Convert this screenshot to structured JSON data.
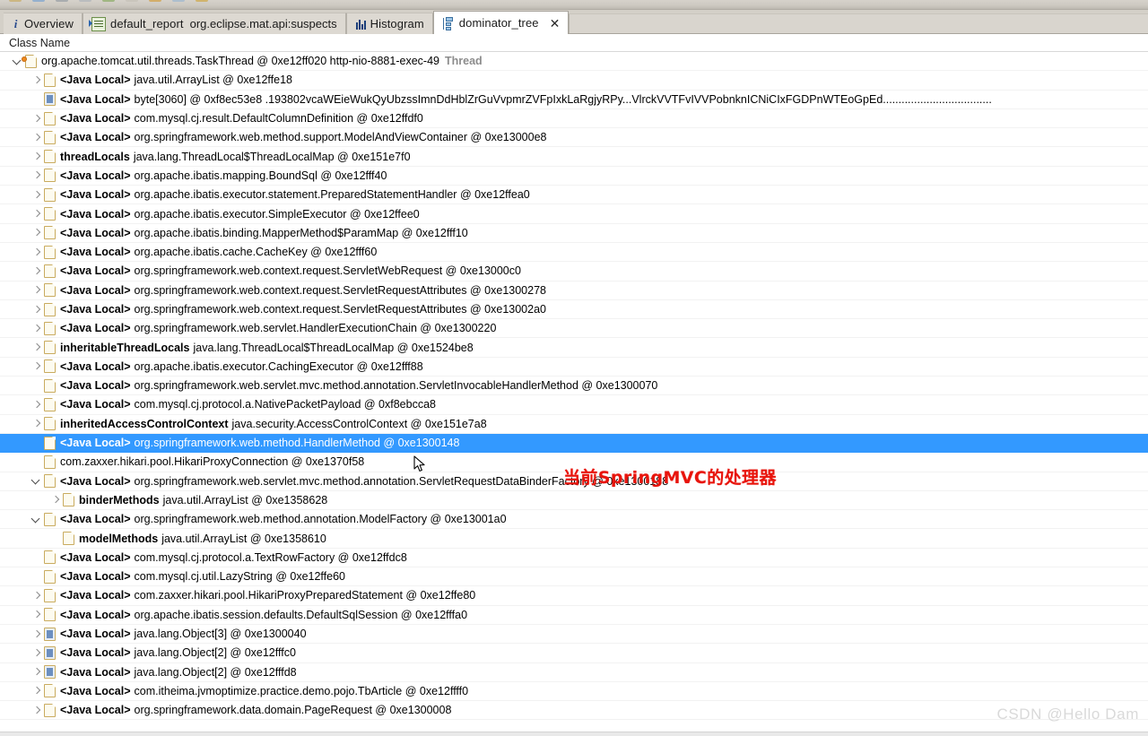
{
  "app": {
    "view_title": "dominator_tree",
    "watermark": "CSDN @Hello Dam"
  },
  "toolbar": {
    "icons": [
      "open-icon",
      "save-icon",
      "print-icon",
      "history-icon",
      "query-icon",
      "inspector-icon",
      "pie-icon",
      "export-icon",
      "settings-icon"
    ]
  },
  "tabs": [
    {
      "label": "Overview",
      "icon": "info-icon",
      "active": false,
      "closable": false,
      "sub": ""
    },
    {
      "label": "default_report",
      "icon": "report-icon",
      "active": false,
      "closable": false,
      "sub": "org.eclipse.mat.api:suspects"
    },
    {
      "label": "Histogram",
      "icon": "histogram-icon",
      "active": false,
      "closable": false,
      "sub": ""
    },
    {
      "label": "dominator_tree",
      "icon": "dominator-tree-icon",
      "active": true,
      "closable": true,
      "sub": ""
    }
  ],
  "tab_close_glyph": "✕",
  "table": {
    "columns": [
      "Class Name"
    ]
  },
  "annotation": {
    "text": "当前SpringMVC的处理器",
    "color": "#e8140c"
  },
  "selection_color": "#3399ff",
  "rows": [
    {
      "indent": 0,
      "twisty": "expanded",
      "icon": "gcroot",
      "strong": "",
      "rest": "org.apache.tomcat.util.threads.TaskThread @ 0xe12ff020  http-nio-8881-exec-49",
      "gray": "Thread",
      "selected": false
    },
    {
      "indent": 1,
      "twisty": "collapsed",
      "icon": "doc",
      "strong": "<Java Local>",
      "rest": "java.util.ArrayList @ 0xe12ffe18",
      "gray": "",
      "selected": false
    },
    {
      "indent": 1,
      "twisty": "none",
      "icon": "array",
      "strong": "<Java Local>",
      "rest": "byte[3060] @ 0xf8ec53e8  .193802vcaWEieWukQyUbzssImnDdHblZrGuVvpmrZVFpIxkLaRgjyRPy...VlrckVVTFvIVVPobnknICNiCIxFGDPnWTEoGpEd...................................",
      "gray": "",
      "selected": false
    },
    {
      "indent": 1,
      "twisty": "collapsed",
      "icon": "doc",
      "strong": "<Java Local>",
      "rest": "com.mysql.cj.result.DefaultColumnDefinition @ 0xe12ffdf0",
      "gray": "",
      "selected": false
    },
    {
      "indent": 1,
      "twisty": "collapsed",
      "icon": "doc",
      "strong": "<Java Local>",
      "rest": "org.springframework.web.method.support.ModelAndViewContainer @ 0xe13000e8",
      "gray": "",
      "selected": false
    },
    {
      "indent": 1,
      "twisty": "collapsed",
      "icon": "doc",
      "strong": "threadLocals",
      "rest": "java.lang.ThreadLocal$ThreadLocalMap @ 0xe151e7f0",
      "gray": "",
      "selected": false
    },
    {
      "indent": 1,
      "twisty": "collapsed",
      "icon": "doc",
      "strong": "<Java Local>",
      "rest": "org.apache.ibatis.mapping.BoundSql @ 0xe12fff40",
      "gray": "",
      "selected": false
    },
    {
      "indent": 1,
      "twisty": "collapsed",
      "icon": "doc",
      "strong": "<Java Local>",
      "rest": "org.apache.ibatis.executor.statement.PreparedStatementHandler @ 0xe12ffea0",
      "gray": "",
      "selected": false
    },
    {
      "indent": 1,
      "twisty": "collapsed",
      "icon": "doc",
      "strong": "<Java Local>",
      "rest": "org.apache.ibatis.executor.SimpleExecutor @ 0xe12ffee0",
      "gray": "",
      "selected": false
    },
    {
      "indent": 1,
      "twisty": "collapsed",
      "icon": "doc",
      "strong": "<Java Local>",
      "rest": "org.apache.ibatis.binding.MapperMethod$ParamMap @ 0xe12fff10",
      "gray": "",
      "selected": false
    },
    {
      "indent": 1,
      "twisty": "collapsed",
      "icon": "doc",
      "strong": "<Java Local>",
      "rest": "org.apache.ibatis.cache.CacheKey @ 0xe12fff60",
      "gray": "",
      "selected": false
    },
    {
      "indent": 1,
      "twisty": "collapsed",
      "icon": "doc",
      "strong": "<Java Local>",
      "rest": "org.springframework.web.context.request.ServletWebRequest @ 0xe13000c0",
      "gray": "",
      "selected": false
    },
    {
      "indent": 1,
      "twisty": "collapsed",
      "icon": "doc",
      "strong": "<Java Local>",
      "rest": "org.springframework.web.context.request.ServletRequestAttributes @ 0xe1300278",
      "gray": "",
      "selected": false
    },
    {
      "indent": 1,
      "twisty": "collapsed",
      "icon": "doc",
      "strong": "<Java Local>",
      "rest": "org.springframework.web.context.request.ServletRequestAttributes @ 0xe13002a0",
      "gray": "",
      "selected": false
    },
    {
      "indent": 1,
      "twisty": "collapsed",
      "icon": "doc",
      "strong": "<Java Local>",
      "rest": "org.springframework.web.servlet.HandlerExecutionChain @ 0xe1300220",
      "gray": "",
      "selected": false
    },
    {
      "indent": 1,
      "twisty": "collapsed",
      "icon": "doc",
      "strong": "inheritableThreadLocals",
      "rest": "java.lang.ThreadLocal$ThreadLocalMap @ 0xe1524be8",
      "gray": "",
      "selected": false
    },
    {
      "indent": 1,
      "twisty": "collapsed",
      "icon": "doc",
      "strong": "<Java Local>",
      "rest": "org.apache.ibatis.executor.CachingExecutor @ 0xe12fff88",
      "gray": "",
      "selected": false
    },
    {
      "indent": 1,
      "twisty": "none",
      "icon": "doc",
      "strong": "<Java Local>",
      "rest": "org.springframework.web.servlet.mvc.method.annotation.ServletInvocableHandlerMethod @ 0xe1300070",
      "gray": "",
      "selected": false
    },
    {
      "indent": 1,
      "twisty": "collapsed",
      "icon": "doc",
      "strong": "<Java Local>",
      "rest": "com.mysql.cj.protocol.a.NativePacketPayload @ 0xf8ebcca8",
      "gray": "",
      "selected": false
    },
    {
      "indent": 1,
      "twisty": "collapsed",
      "icon": "doc",
      "strong": "inheritedAccessControlContext",
      "rest": "java.security.AccessControlContext @ 0xe151e7a8",
      "gray": "",
      "selected": false
    },
    {
      "indent": 1,
      "twisty": "none",
      "icon": "doc",
      "strong": "<Java Local>",
      "rest": "org.springframework.web.method.HandlerMethod @ 0xe1300148",
      "gray": "",
      "selected": true
    },
    {
      "indent": 1,
      "twisty": "none",
      "icon": "doc",
      "strong": "",
      "rest": "com.zaxxer.hikari.pool.HikariProxyConnection @ 0xe1370f58",
      "gray": "",
      "selected": false
    },
    {
      "indent": 1,
      "twisty": "expanded",
      "icon": "doc",
      "strong": "<Java Local>",
      "rest": "org.springframework.web.servlet.mvc.method.annotation.ServletRequestDataBinderFactory @ 0xe1300188",
      "gray": "",
      "selected": false
    },
    {
      "indent": 2,
      "twisty": "collapsed",
      "icon": "doc",
      "strong": "binderMethods",
      "rest": "java.util.ArrayList @ 0xe1358628",
      "gray": "",
      "selected": false
    },
    {
      "indent": 1,
      "twisty": "expanded",
      "icon": "doc",
      "strong": "<Java Local>",
      "rest": "org.springframework.web.method.annotation.ModelFactory @ 0xe13001a0",
      "gray": "",
      "selected": false
    },
    {
      "indent": 2,
      "twisty": "none",
      "icon": "doc",
      "strong": "modelMethods",
      "rest": "java.util.ArrayList @ 0xe1358610",
      "gray": "",
      "selected": false
    },
    {
      "indent": 1,
      "twisty": "none",
      "icon": "doc",
      "strong": "<Java Local>",
      "rest": "com.mysql.cj.protocol.a.TextRowFactory @ 0xe12ffdc8",
      "gray": "",
      "selected": false
    },
    {
      "indent": 1,
      "twisty": "none",
      "icon": "doc",
      "strong": "<Java Local>",
      "rest": "com.mysql.cj.util.LazyString @ 0xe12ffe60",
      "gray": "",
      "selected": false
    },
    {
      "indent": 1,
      "twisty": "collapsed",
      "icon": "doc",
      "strong": "<Java Local>",
      "rest": "com.zaxxer.hikari.pool.HikariProxyPreparedStatement @ 0xe12ffe80",
      "gray": "",
      "selected": false
    },
    {
      "indent": 1,
      "twisty": "collapsed",
      "icon": "doc",
      "strong": "<Java Local>",
      "rest": "org.apache.ibatis.session.defaults.DefaultSqlSession @ 0xe12fffa0",
      "gray": "",
      "selected": false
    },
    {
      "indent": 1,
      "twisty": "collapsed",
      "icon": "array",
      "strong": "<Java Local>",
      "rest": "java.lang.Object[3] @ 0xe1300040",
      "gray": "",
      "selected": false
    },
    {
      "indent": 1,
      "twisty": "collapsed",
      "icon": "array",
      "strong": "<Java Local>",
      "rest": "java.lang.Object[2] @ 0xe12fffc0",
      "gray": "",
      "selected": false
    },
    {
      "indent": 1,
      "twisty": "collapsed",
      "icon": "array",
      "strong": "<Java Local>",
      "rest": "java.lang.Object[2] @ 0xe12fffd8",
      "gray": "",
      "selected": false
    },
    {
      "indent": 1,
      "twisty": "collapsed",
      "icon": "doc",
      "strong": "<Java Local>",
      "rest": "com.itheima.jvmoptimize.practice.demo.pojo.TbArticle @ 0xe12ffff0",
      "gray": "",
      "selected": false
    },
    {
      "indent": 1,
      "twisty": "collapsed",
      "icon": "doc",
      "strong": "<Java Local>",
      "rest": "org.springframework.data.domain.PageRequest @ 0xe1300008",
      "gray": "",
      "selected": false
    }
  ]
}
